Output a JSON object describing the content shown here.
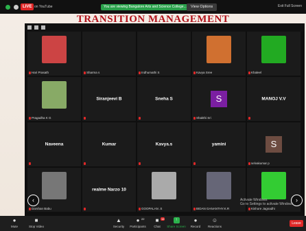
{
  "slide": {
    "title": "TRANSITION MANAGEMENT"
  },
  "topbar": {
    "live_label": "LIVE",
    "live_on": "on YouTube",
    "share_banner": "You are viewing Bangalore Arts and Science College... s screen",
    "view_options": "View Options",
    "exit_fullscreen": "Exit Full Screen"
  },
  "gallery": {
    "tiles": [
      {
        "name": "Hari Prasath",
        "type": "video",
        "color": "#c44"
      },
      {
        "name": "Sharma s",
        "type": "blank"
      },
      {
        "name": "Indhumathi S",
        "type": "blank"
      },
      {
        "name": "Kavya Sree",
        "type": "video",
        "color": "#d07030"
      },
      {
        "name": "Khaleel",
        "type": "video",
        "color": "#2a2"
      },
      {
        "name": "Pragadha K G",
        "type": "video",
        "color": "#8a6"
      },
      {
        "name": "Siranjeevi B",
        "type": "big"
      },
      {
        "name": "Sneha S",
        "type": "big"
      },
      {
        "name": "Shakthi Sri",
        "type": "avatar",
        "letter": "S",
        "color": "#7b1fa2"
      },
      {
        "name": "MANOJ V.V",
        "type": "big"
      },
      {
        "name": "Naveena",
        "type": "big"
      },
      {
        "name": "Kumar",
        "type": "big"
      },
      {
        "name": "Kavya.s",
        "type": "big"
      },
      {
        "name": "yamini",
        "type": "big"
      },
      {
        "name": "selvakumar p",
        "type": "avatar",
        "letter": "S",
        "color": "#6d4c41"
      },
      {
        "name": "Darshan Babu",
        "type": "video",
        "color": "#777"
      },
      {
        "name": "realme Narzo 10",
        "type": "big"
      },
      {
        "name": "GOOPALAN .S",
        "type": "video",
        "color": "#aaa"
      },
      {
        "name": "BIDAN GANANTHY.K.R",
        "type": "video",
        "color": "#667"
      },
      {
        "name": "Kishore Jagnadhi",
        "type": "video",
        "color": "#3c3"
      }
    ],
    "activate": "Activate Windows\nGo to Settings to activate Windows"
  },
  "toolbar": {
    "mute": "Mute",
    "stop_video": "Stop Video",
    "security": "Security",
    "participants": "Participants",
    "participants_count": "22",
    "chat": "Chat",
    "chat_badge": "16",
    "share_screen": "Share Screen",
    "record": "Record",
    "reactions": "Reactions",
    "leave": "Leave"
  }
}
